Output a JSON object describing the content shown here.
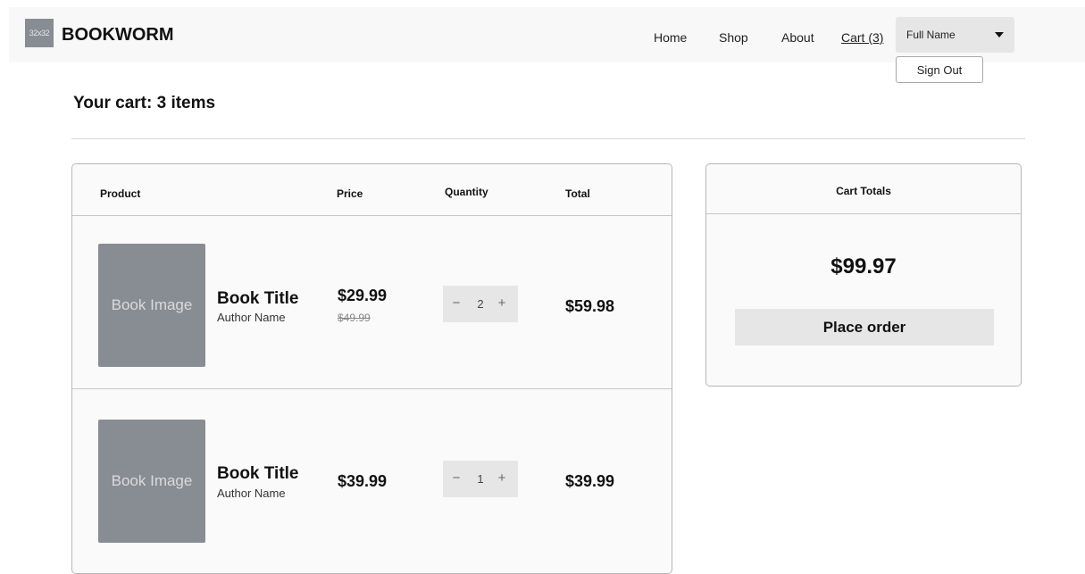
{
  "header": {
    "logo_placeholder": "32x32",
    "brand": "BOOKWORM",
    "nav": {
      "home": "Home",
      "shop": "Shop",
      "about": "About",
      "cart": "Cart (3)"
    },
    "user_menu": {
      "selected": "Full Name",
      "sign_out": "Sign Out"
    }
  },
  "page": {
    "title": "Your cart: 3 items"
  },
  "cart_table": {
    "columns": {
      "product": "Product",
      "price": "Price",
      "quantity": "Quantity",
      "total": "Total"
    },
    "items": [
      {
        "image_placeholder": "Book Image",
        "title": "Book Title",
        "author": "Author Name",
        "price": "$29.99",
        "original_price": "$49.99",
        "quantity": "2",
        "total": "$59.98"
      },
      {
        "image_placeholder": "Book Image",
        "title": "Book Title",
        "author": "Author Name",
        "price": "$39.99",
        "quantity": "1",
        "total": "$39.99"
      }
    ],
    "stepper": {
      "minus": "−",
      "plus": "+"
    }
  },
  "totals": {
    "heading": "Cart Totals",
    "amount": "$99.97",
    "place_order": "Place order"
  }
}
